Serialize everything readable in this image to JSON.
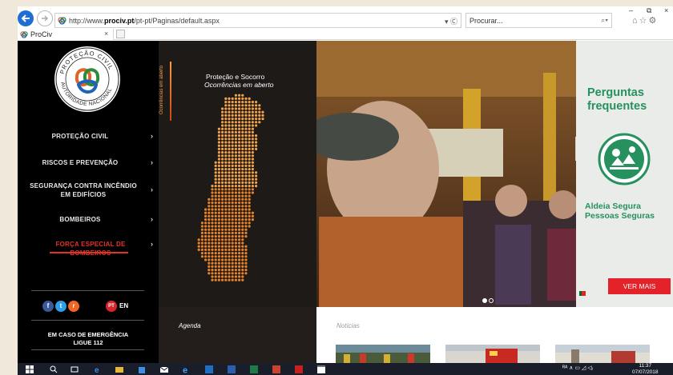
{
  "browser": {
    "url_prefix": "http://www.",
    "url_domain": "prociv.pt",
    "url_path": "/pt-pt/Paginas/default.aspx",
    "url_tools": "▾ Ⓒ",
    "search_placeholder": "Procurar...",
    "search_icon": "⌕▾",
    "tab_title": "ProCiv",
    "tab_close": "×",
    "window_controls": {
      "minimize": "–",
      "restore": "⧉",
      "close": "×"
    },
    "right_icons": "⌂☆⚙"
  },
  "sidebar": {
    "logo_ring_top": "PROTEÇÃO CIVIL",
    "logo_ring_bottom": "AUTORIDADE NACIONAL",
    "items": [
      {
        "label": "PROTEÇÃO CIVIL",
        "chevron": "›"
      },
      {
        "label": "RISCOS E PREVENÇÃO",
        "chevron": "›"
      },
      {
        "label": "SEGURANÇA CONTRA INCÊNDIO EM EDIFÍCIOS",
        "chevron": "›"
      },
      {
        "label": "BOMBEIROS",
        "chevron": "›"
      },
      {
        "label": "FORÇA ESPECIAL DE BOMBEIROS",
        "chevron": "›",
        "active": true
      }
    ],
    "social": {
      "facebook": "f",
      "twitter": "t",
      "rss": "r"
    },
    "lang_pt": "PT",
    "lang_en": "EN",
    "emergency_line1": "EM CASO DE EMERGÊNCIA",
    "emergency_line2": "LIGUE 112"
  },
  "hero": {
    "vertical_label": "Ocorrências em aberto",
    "title": "Proteção e Socorro",
    "subtitle": "Ocorrências em aberto",
    "active_slide": 1,
    "slide_count": 2
  },
  "promo": {
    "title_line1": "Perguntas",
    "title_line2": "frequentes",
    "sub_line1": "Aldeia Segura",
    "sub_line2": "Pessoas Seguras",
    "button": "VER MAIS"
  },
  "bottom": {
    "agenda": "Agenda",
    "news": "Notícias"
  },
  "taskbar": {
    "tray": "ᴿᴬ  ∧  ▭  ◿  ◁ᵢ",
    "time": "11:37",
    "date": "07/07/2018"
  },
  "colors": {
    "accent_red": "#e3312b",
    "promo_green": "#26915e",
    "map_orange": "#f08a2e",
    "ie_blue": "#1f6fd1"
  }
}
